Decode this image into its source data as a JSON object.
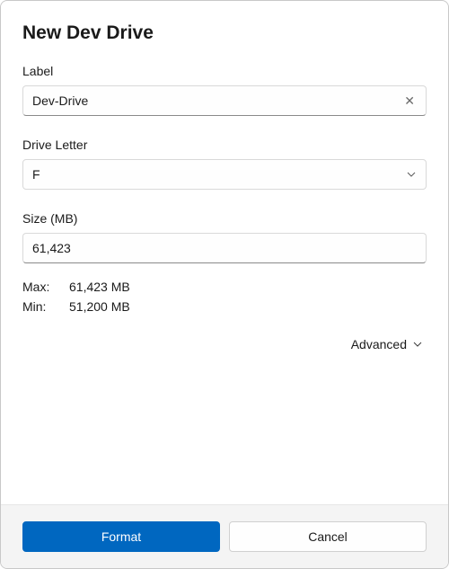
{
  "title": "New Dev Drive",
  "label_field": {
    "label": "Label",
    "value": "Dev-Drive"
  },
  "drive_letter": {
    "label": "Drive Letter",
    "value": "F"
  },
  "size": {
    "label": "Size (MB)",
    "value": "61,423"
  },
  "limits": {
    "max_label": "Max:",
    "max_value": "61,423 MB",
    "min_label": "Min:",
    "min_value": "51,200 MB"
  },
  "advanced_label": "Advanced",
  "buttons": {
    "format": "Format",
    "cancel": "Cancel"
  }
}
